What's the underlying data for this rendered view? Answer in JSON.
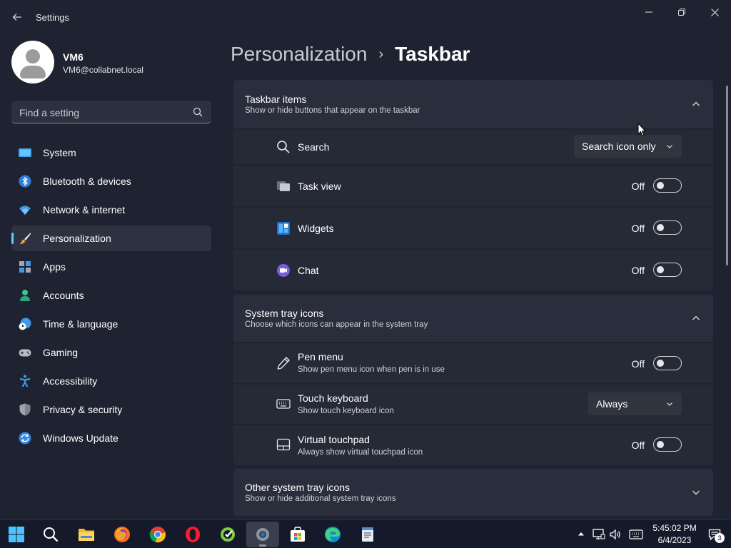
{
  "window": {
    "title": "Settings",
    "controls": {
      "minimize": "minimize-icon",
      "maximize": "restore-icon",
      "close": "close-icon"
    }
  },
  "profile": {
    "name": "VM6",
    "email": "VM6@collabnet.local"
  },
  "search": {
    "placeholder": "Find a setting"
  },
  "nav": {
    "items": [
      {
        "label": "System",
        "icon": "system-icon"
      },
      {
        "label": "Bluetooth & devices",
        "icon": "bluetooth-icon"
      },
      {
        "label": "Network & internet",
        "icon": "wifi-icon"
      },
      {
        "label": "Personalization",
        "icon": "paintbrush-icon",
        "active": true
      },
      {
        "label": "Apps",
        "icon": "apps-icon"
      },
      {
        "label": "Accounts",
        "icon": "accounts-icon"
      },
      {
        "label": "Time & language",
        "icon": "globe-clock-icon"
      },
      {
        "label": "Gaming",
        "icon": "gamepad-icon"
      },
      {
        "label": "Accessibility",
        "icon": "accessibility-icon"
      },
      {
        "label": "Privacy & security",
        "icon": "shield-icon"
      },
      {
        "label": "Windows Update",
        "icon": "update-icon"
      }
    ]
  },
  "breadcrumb": {
    "parent": "Personalization",
    "separator": "›",
    "current": "Taskbar"
  },
  "sections": {
    "taskbar_items": {
      "title": "Taskbar items",
      "subtitle": "Show or hide buttons that appear on the taskbar",
      "expanded": true,
      "rows": {
        "search": {
          "label": "Search",
          "value": "Search icon only"
        },
        "task_view": {
          "label": "Task view",
          "state": "Off"
        },
        "widgets": {
          "label": "Widgets",
          "state": "Off"
        },
        "chat": {
          "label": "Chat",
          "state": "Off"
        }
      }
    },
    "system_tray": {
      "title": "System tray icons",
      "subtitle": "Choose which icons can appear in the system tray",
      "expanded": true,
      "rows": {
        "pen_menu": {
          "label": "Pen menu",
          "sub": "Show pen menu icon when pen is in use",
          "state": "Off"
        },
        "touch_keyboard": {
          "label": "Touch keyboard",
          "sub": "Show touch keyboard icon",
          "value": "Always"
        },
        "virtual_touchpad": {
          "label": "Virtual touchpad",
          "sub": "Always show virtual touchpad icon",
          "state": "Off"
        }
      }
    },
    "other_tray": {
      "title": "Other system tray icons",
      "subtitle": "Show or hide additional system tray icons",
      "expanded": false
    }
  },
  "taskbar": {
    "apps": [
      "start-icon",
      "search-icon",
      "file-explorer-icon",
      "firefox-icon",
      "chrome-icon",
      "opera-icon",
      "app-icon",
      "settings-icon",
      "store-icon",
      "edge-icon",
      "notepad-icon"
    ],
    "time": "5:45:02 PM",
    "date": "6/4/2023",
    "notification_count": "3"
  },
  "colors": {
    "accent": "#60cdff",
    "background": "#1f2331",
    "card": "#2a2e3c",
    "row": "#262a37"
  }
}
